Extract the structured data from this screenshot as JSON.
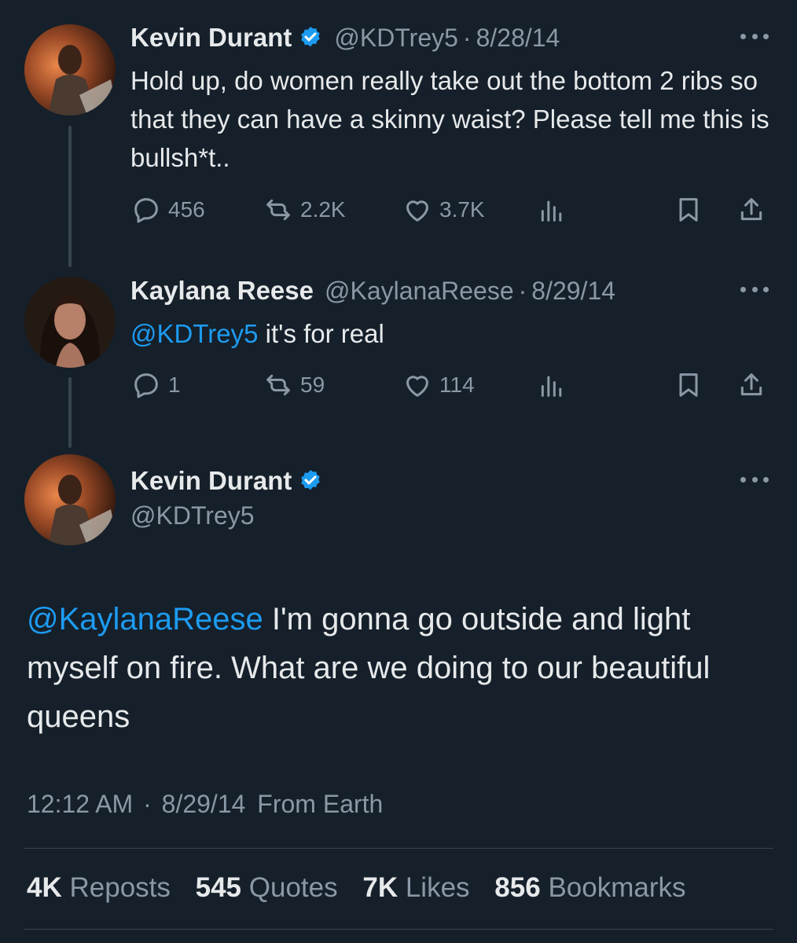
{
  "tweets": [
    {
      "name": "Kevin Durant",
      "handle": "@KDTrey5",
      "date": "8/28/14",
      "text": "Hold up, do women really take out the bottom 2 ribs so that they can have a skinny waist? Please tell me this is bullsh*t..",
      "replies": "456",
      "reposts": "2.2K",
      "likes": "3.7K",
      "verified": true
    },
    {
      "name": "Kaylana Reese",
      "handle": "@KaylanaReese",
      "date": "8/29/14",
      "mention": "@KDTrey5",
      "text": " it's for real",
      "replies": "1",
      "reposts": "59",
      "likes": "114",
      "verified": false
    }
  ],
  "main": {
    "name": "Kevin Durant",
    "handle": "@KDTrey5",
    "mention": "@KaylanaReese",
    "text": " I'm gonna go outside and light myself on fire. What are we doing to our beautiful queens",
    "time": "12:12 AM",
    "date": "8/29/14",
    "source": "From Earth",
    "stats": {
      "reposts_count": "4K",
      "reposts_label": "Reposts",
      "quotes_count": "545",
      "quotes_label": "Quotes",
      "likes_count": "7K",
      "likes_label": "Likes",
      "bookmarks_count": "856",
      "bookmarks_label": "Bookmarks"
    }
  },
  "separator": "·",
  "colors": {
    "background": "#15202b",
    "accent": "#1d9bf0",
    "muted": "#8b98a5",
    "text": "#e7e9ea"
  },
  "icons": [
    "reply-icon",
    "repost-icon",
    "like-icon",
    "views-icon",
    "bookmark-icon",
    "share-icon",
    "verified-badge-icon",
    "more-icon"
  ]
}
